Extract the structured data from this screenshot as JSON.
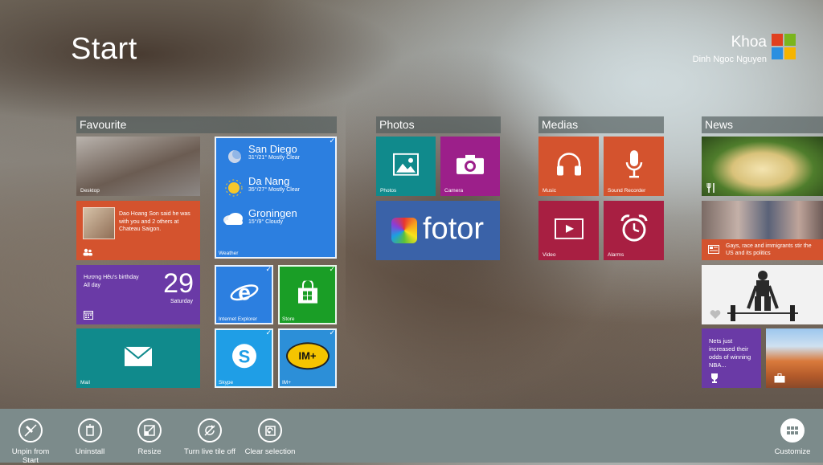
{
  "start": {
    "title": "Start"
  },
  "user": {
    "name": "Khoa",
    "fullname": "Dinh Ngoc Nguyen"
  },
  "groups": {
    "favourite": "Favourite",
    "photos": "Photos",
    "medias": "Medias",
    "news": "News"
  },
  "tiles": {
    "desktop": "Desktop",
    "people_text": "Dao Hoang Son said he was with you and 2 others at Chateau Saigon.",
    "calendar_event": "Hương Hêu's birthday",
    "calendar_allday": "All day",
    "calendar_date": "29",
    "calendar_day": "Saturday",
    "mail": "Mail",
    "weather": {
      "label": "Weather",
      "cities": [
        {
          "name": "San Diego",
          "detail": "31°/21° Mostly Clear"
        },
        {
          "name": "Da Nang",
          "detail": "35°/27° Mostly Clear"
        },
        {
          "name": "Groningen",
          "detail": "15°/9° Cloudy"
        }
      ]
    },
    "ie": "Internet Explorer",
    "store": "Store",
    "skype": "Skype",
    "implus": "IM+",
    "implus_logo": "IM+",
    "photos": "Photos",
    "camera": "Camera",
    "fotor": "fotor",
    "music": "Music",
    "sound_recorder": "Sound Recorder",
    "video": "Video",
    "alarms": "Alarms",
    "news_headline": "Gays, race and immigrants stir the US and its politics",
    "sports_text": "Nets just increased their odds of winning NBA..."
  },
  "appbar": {
    "unpin": "Unpin from Start",
    "uninstall": "Uninstall",
    "resize": "Resize",
    "live_tile": "Turn live tile off",
    "clear": "Clear selection",
    "customize": "Customize"
  },
  "colors": {
    "accent_orange": "#d4532e",
    "purple": "#6a3aa6",
    "teal": "#108a8c",
    "blue": "#2c7fe0",
    "green": "#1a9e26",
    "magenta": "#9c1f8a",
    "red": "#a81f42",
    "appbar": "#7c8b8b"
  }
}
